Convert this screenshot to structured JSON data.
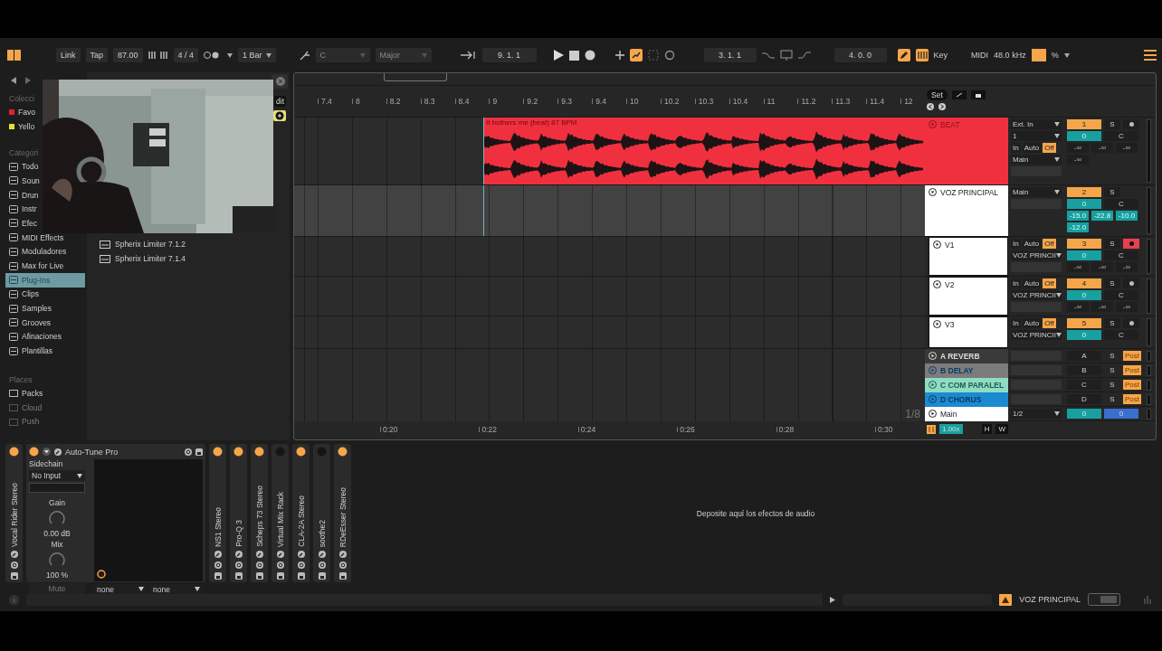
{
  "toolbar": {
    "link": "Link",
    "tap": "Tap",
    "tempo": "87.00",
    "signature": "4 / 4",
    "quantize": "1 Bar",
    "key_root": "C",
    "scale": {
      "text": "Major",
      "disabled": true
    },
    "position": "9. 1. 1",
    "automation_arm": true,
    "loop_start": "3. 1. 1",
    "loop_length": "4. 0. 0",
    "draw_mode": true,
    "computer_keyboard": true,
    "key_label": "Key",
    "midi_label": "MIDI",
    "sample_rate": "48.0 kHz",
    "cpu": "%"
  },
  "browser": {
    "collections_heading": "Colecci",
    "collections": [
      {
        "label": "Favo",
        "color": "#e8202c"
      },
      {
        "label": "Yello",
        "color": "#e6e034"
      }
    ],
    "categories_heading": "Categori",
    "categories": [
      {
        "label": "Todo",
        "selected": false
      },
      {
        "label": "Soun",
        "selected": false
      },
      {
        "label": "Drun",
        "selected": false
      },
      {
        "label": "Instr",
        "selected": false
      },
      {
        "label": "Efec",
        "selected": false
      },
      {
        "label": "MIDI Effects",
        "selected": false
      },
      {
        "label": "Moduladores",
        "selected": false
      },
      {
        "label": "Max for Live",
        "selected": false
      },
      {
        "label": "Plug-Ins",
        "selected": true
      },
      {
        "label": "Clips",
        "selected": false
      },
      {
        "label": "Samples",
        "selected": false
      },
      {
        "label": "Grooves",
        "selected": false
      },
      {
        "label": "Afinaciones",
        "selected": false
      },
      {
        "label": "Plantillas",
        "selected": false
      }
    ],
    "places_heading": "Places",
    "places": [
      {
        "label": "Packs",
        "disabled": false
      },
      {
        "label": "Cloud",
        "disabled": true
      },
      {
        "label": "Push",
        "disabled": true
      }
    ],
    "edit": "dit",
    "files": [
      "Spherix Limiter 7.1.2",
      "Spherix Limiter 7.1.4"
    ],
    "webcam": {
      "kind": "picture"
    }
  },
  "arrangement": {
    "set": "Set",
    "bars": [
      "7.4",
      "8",
      "8.2",
      "8.3",
      "8.4",
      "9",
      "9.2",
      "9.3",
      "9.4",
      "10",
      "10.2",
      "10.3",
      "10.4",
      "11",
      "11.2",
      "11.3",
      "11.4",
      "12"
    ],
    "tracks": [
      {
        "name": "BEAT",
        "color": "#f0303f",
        "clip": {
          "name": "It bothers me (beat) 87 BPM"
        },
        "io": [
          {
            "kind": "select",
            "text": "Ext. In"
          },
          {
            "kind": "select",
            "text": "1"
          },
          {
            "kind": "monitor",
            "options": [
              {
                "label": "In",
                "selected": false
              },
              {
                "label": "Auto",
                "selected": false
              },
              {
                "label": "Off",
                "selected": true
              }
            ]
          },
          {
            "kind": "select",
            "text": "Main"
          },
          {
            "kind": "blank"
          }
        ],
        "number": "1",
        "solo": "S",
        "armed": false,
        "volume": "0",
        "pan": "C",
        "sends": [
          {
            "value": "-∞",
            "active": false
          },
          {
            "value": "-∞",
            "active": false
          },
          {
            "value": "-∞",
            "active": false
          }
        ],
        "extra": [
          {
            "value": "-∞",
            "active": false
          }
        ]
      },
      {
        "name": "VOZ PRINCIPAL",
        "color": "#ffffff",
        "io": [
          {
            "kind": "select",
            "text": "Main"
          },
          {
            "kind": "blank"
          }
        ],
        "number": "2",
        "solo": "S",
        "volume": "0",
        "pan": "C",
        "sends": [
          {
            "value": "-15.0",
            "active": true
          },
          {
            "value": "-22.8",
            "active": true
          },
          {
            "value": "-10.0",
            "active": true
          }
        ],
        "extra": [
          {
            "value": "-12.0",
            "active": true
          }
        ],
        "children": [
          {
            "name": "V1",
            "color": "#ffffff",
            "io": [
              {
                "kind": "monitor",
                "options": [
                  {
                    "label": "In",
                    "selected": false
                  },
                  {
                    "label": "Auto",
                    "selected": false
                  },
                  {
                    "label": "Off",
                    "selected": true
                  }
                ]
              },
              {
                "kind": "select",
                "text": "VOZ PRINCII"
              },
              {
                "kind": "blank"
              }
            ],
            "number": "3",
            "solo": "S",
            "armed": true,
            "volume": "0",
            "pan": "C",
            "sends": [
              {
                "value": "-∞",
                "active": false
              },
              {
                "value": "-∞",
                "active": false
              },
              {
                "value": "-∞",
                "active": false
              }
            ]
          },
          {
            "name": "V2",
            "color": "#ffffff",
            "io": [
              {
                "kind": "monitor",
                "options": [
                  {
                    "label": "In",
                    "selected": false
                  },
                  {
                    "label": "Auto",
                    "selected": false
                  },
                  {
                    "label": "Off",
                    "selected": true
                  }
                ]
              },
              {
                "kind": "select",
                "text": "VOZ PRINCII"
              },
              {
                "kind": "blank"
              }
            ],
            "number": "4",
            "solo": "S",
            "armed": false,
            "volume": "0",
            "pan": "C",
            "sends": [
              {
                "value": "-∞",
                "active": false
              },
              {
                "value": "-∞",
                "active": false
              },
              {
                "value": "-∞",
                "active": false
              }
            ]
          },
          {
            "name": "V3",
            "color": "#ffffff",
            "io": [
              {
                "kind": "monitor",
                "options": [
                  {
                    "label": "In",
                    "selected": false
                  },
                  {
                    "label": "Auto",
                    "selected": false
                  },
                  {
                    "label": "Off",
                    "selected": true
                  }
                ]
              },
              {
                "kind": "select",
                "text": "VOZ PRINCII"
              }
            ],
            "number": "5",
            "solo": "S",
            "armed": false,
            "volume": "0",
            "pan": "C"
          }
        ]
      }
    ],
    "returns": [
      {
        "name": "A REVERB",
        "color": "#3a3a3a",
        "letter": "A",
        "solo": "S",
        "post": "Post"
      },
      {
        "name": "B DELAY",
        "color": "#7c7c7c",
        "letter": "B",
        "solo": "S",
        "post": "Post"
      },
      {
        "name": "C COM PARALEL",
        "color": "#8fdcc4",
        "letter": "C",
        "solo": "S",
        "post": "Post"
      },
      {
        "name": "D CHORUS",
        "color": "#1b8ad0",
        "letter": "D",
        "solo": "S",
        "post": "Post"
      }
    ],
    "main": {
      "name": "Main",
      "color": "#ffffff",
      "output": "1/2",
      "volume": "0",
      "pan": "0",
      "zoom_label": "1/8"
    },
    "times": [
      "0:20",
      "0:22",
      "0:24",
      "0:26",
      "0:28",
      "0:30"
    ],
    "speed": "1.00x",
    "h_button": "H",
    "w_button": "W"
  },
  "devices": [
    {
      "name": "Vocal Rider Stereo",
      "kind": "folded",
      "on": true
    },
    {
      "name": "Auto-Tune Pro",
      "kind": "expanded",
      "on": true,
      "sidechain_label": "Sidechain",
      "sidechain": "No Input",
      "gain_label": "Gain",
      "gain": "0.00 dB",
      "mix_label": "Mix",
      "mix": "100 %",
      "mute": "Mute",
      "macros": [
        "none",
        "none"
      ]
    },
    {
      "name": "NS1 Stereo",
      "kind": "folded",
      "on": true
    },
    {
      "name": "Pro-Q 3",
      "kind": "folded",
      "on": true
    },
    {
      "name": "Scheps 73 Stereo",
      "kind": "folded",
      "on": true
    },
    {
      "name": "Virtual Mix Rack",
      "kind": "folded",
      "on": false
    },
    {
      "name": "CLA-2A Stereo",
      "kind": "folded",
      "on": true
    },
    {
      "name": "soothe2",
      "kind": "folded",
      "on": false
    },
    {
      "name": "RDeEsser Stereo",
      "kind": "folded",
      "on": true
    }
  ],
  "drop_hint": "Deposite aquí los efectos de audio",
  "status_bar": {
    "track": "VOZ PRINCIPAL"
  }
}
